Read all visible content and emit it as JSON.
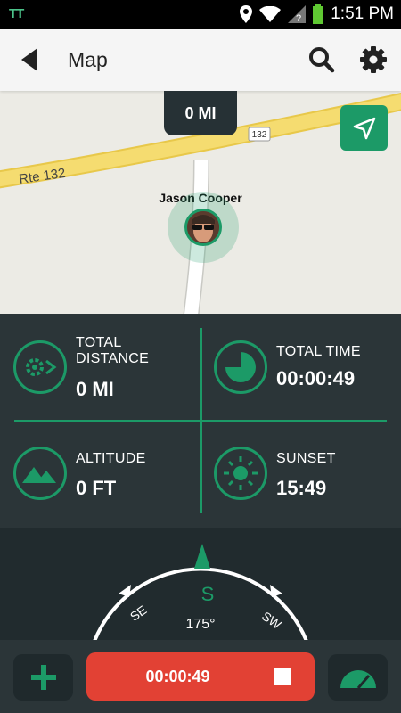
{
  "status_bar": {
    "left_icon": "TT",
    "time": "1:51 PM"
  },
  "app_bar": {
    "title": "Map"
  },
  "map": {
    "distance": "0 MI",
    "road_label": "Rte 132",
    "road_shield": "132",
    "user_name": "Jason Cooper"
  },
  "stats": {
    "total_distance": {
      "label_line1": "TOTAL",
      "label_line2": "DISTANCE",
      "value": "0 MI"
    },
    "total_time": {
      "label": "TOTAL TIME",
      "value": "00:00:49"
    },
    "altitude": {
      "label": "ALTITUDE",
      "value": "0 FT"
    },
    "sunset": {
      "label": "SUNSET",
      "value": "15:49"
    }
  },
  "compass": {
    "heading": "S",
    "degrees": "175°",
    "left_dir": "SE",
    "right_dir": "SW"
  },
  "bottom_bar": {
    "timer": "00:00:49"
  },
  "colors": {
    "accent": "#1c9a67",
    "panel": "#2b3538",
    "record": "#e24134"
  }
}
